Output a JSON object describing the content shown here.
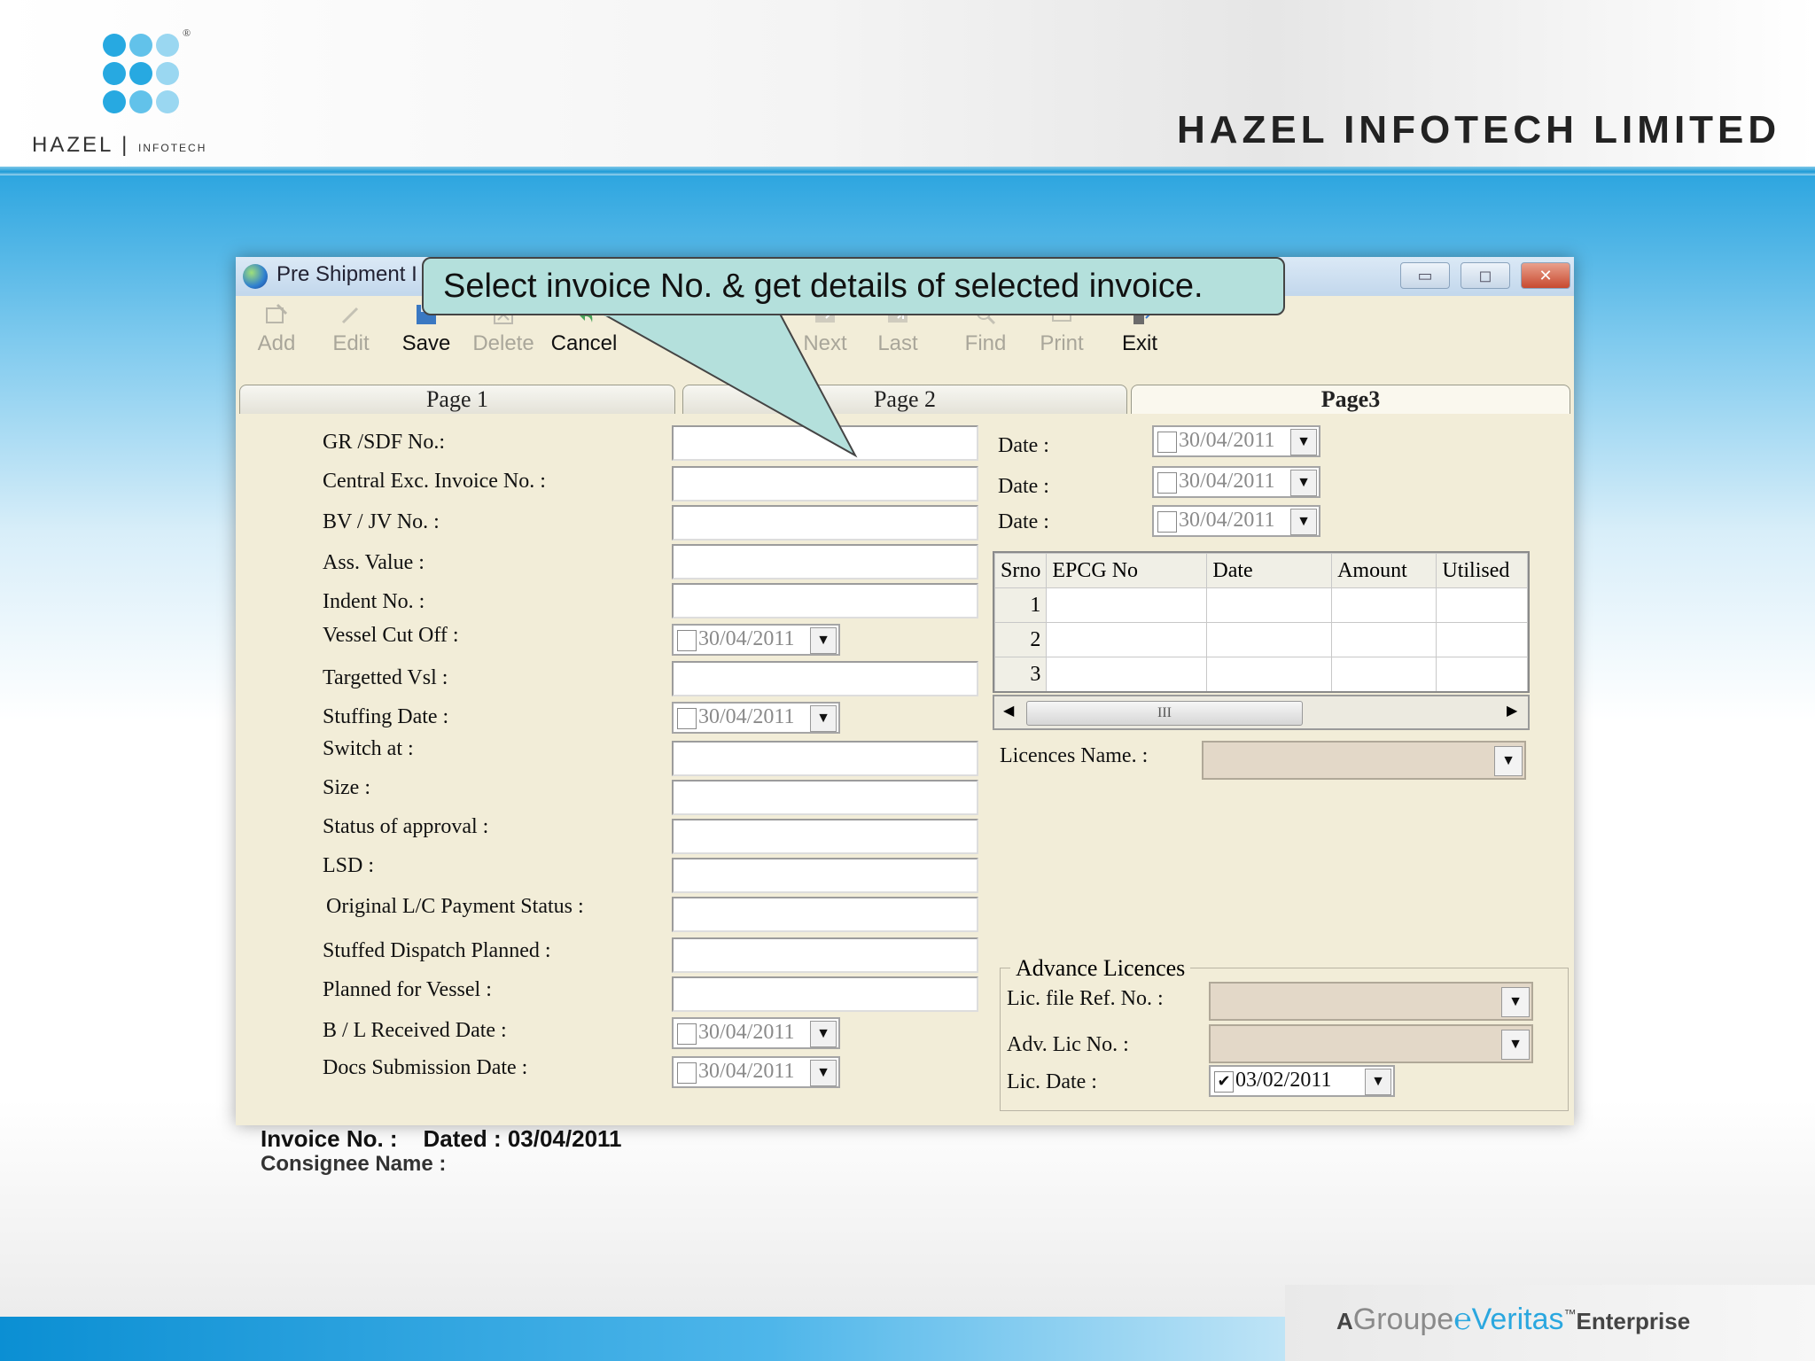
{
  "slide": {
    "logo_text": "HAZEL",
    "logo_sub": "INFOTECH",
    "company_name": "HAZEL INFOTECH LIMITED",
    "footer_a": "A",
    "footer_groupe": "Groupe",
    "footer_veritas": "Veritas",
    "footer_tm": "™",
    "footer_enterprise": "Enterprise",
    "colors": {
      "brand_blue": "#1c9ad6",
      "callout_bg": "#b4e0dc",
      "window_bg": "#f2edd8"
    }
  },
  "window": {
    "title": "Pre Shipment I",
    "controls": [
      "minimize-icon",
      "maximize-icon",
      "close-icon"
    ]
  },
  "toolbar": {
    "add": "Add",
    "edit": "Edit",
    "save": "Save",
    "delete": "Delete",
    "cancel": "Cancel",
    "next": "Next",
    "last": "Last",
    "find": "Find",
    "print": "Print",
    "exit": "Exit"
  },
  "tabs": [
    "Page 1",
    "Page 2",
    "Page3"
  ],
  "callout": "Select invoice No. & get details of selected invoice.",
  "left_form": {
    "gr_sdf": "GR /SDF  No.:",
    "central_exc": "Central Exc. Invoice No. :",
    "bv_jv": "BV / JV No. :",
    "ass_value": "Ass. Value    :",
    "indent": "Indent No. :",
    "vessel_cutoff": "Vessel Cut Off :",
    "targetted_vsl": "Targetted Vsl :",
    "stuffing_date": "Stuffing Date :",
    "switch_at": "Switch at :",
    "size": "Size :",
    "status_approval": "Status of approval :",
    "lsd": "LSD :",
    "original_lc": "Original L/C  Payment Status :",
    "stuffed_dispatch": "Stuffed Dispatch Planned :",
    "planned_vessel": "Planned for Vessel :",
    "bl_received": "B / L Received Date :",
    "docs_submission": "Docs Submission Date :"
  },
  "dates": {
    "default": "30/04/2011",
    "lic_date": "03/02/2011"
  },
  "right_form": {
    "date_label": "Date :",
    "licences_name": "Licences Name. :"
  },
  "grid": {
    "headers": [
      "Srno",
      "EPCG  No",
      "Date",
      "Amount",
      "Utilised"
    ],
    "rows": [
      "1",
      "2",
      "3"
    ],
    "scroll_grip": "III"
  },
  "advance": {
    "legend": "Advance Licences",
    "lic_file_ref": "Lic. file Ref. No. :",
    "adv_lic_no": "Adv. Lic No. :",
    "lic_date": "Lic. Date :"
  },
  "status": {
    "invoice_label": "Invoice No. :",
    "dated_label": "Dated : 03/04/2011",
    "consignee": "Consignee Name :"
  }
}
